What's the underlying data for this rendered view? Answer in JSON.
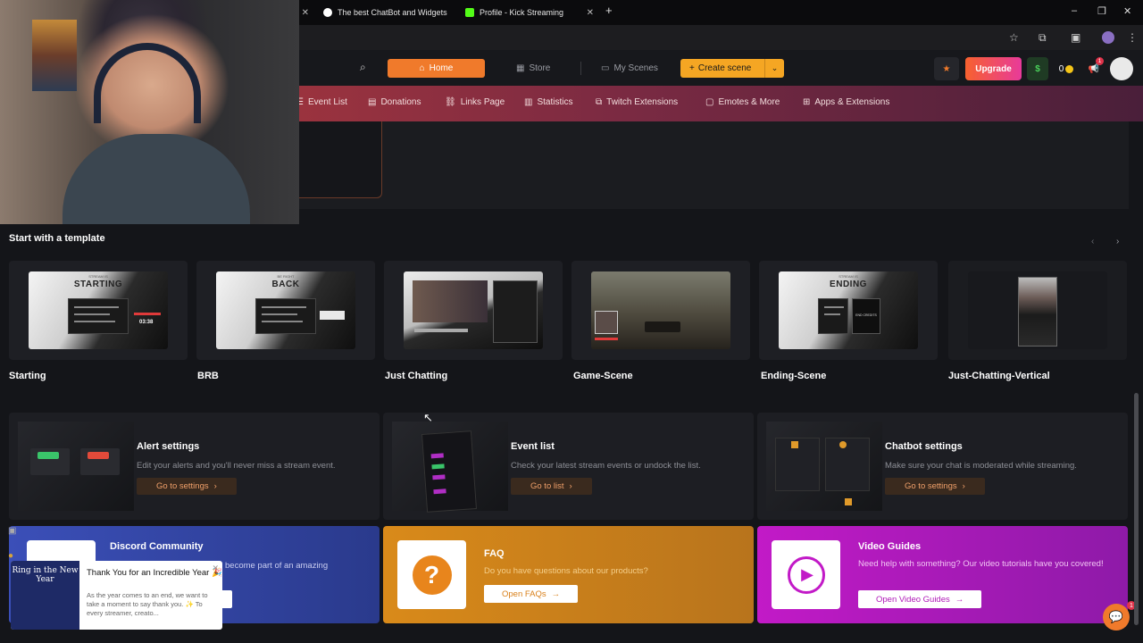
{
  "browser": {
    "tabs": [
      {
        "title": "The best ChatBot and Widgets",
        "close": "✕"
      },
      {
        "title": "Profile - Kick Streaming",
        "close": "✕"
      }
    ],
    "new_tab": "+",
    "window_controls": {
      "minimize": "–",
      "maximize": "❐",
      "close": "✕"
    }
  },
  "header": {
    "home": "Home",
    "store": "Store",
    "my_scenes": "My Scenes",
    "create_scene": "Create scene",
    "upgrade": "Upgrade",
    "dollar": "$",
    "coins": "0",
    "notif_count": "1"
  },
  "subnav": {
    "items": [
      {
        "label": "Event List",
        "icon": "list-icon"
      },
      {
        "label": "Donations",
        "icon": "donation-icon"
      },
      {
        "label": "Links Page",
        "icon": "link-icon"
      },
      {
        "label": "Statistics",
        "icon": "stats-icon"
      },
      {
        "label": "Twitch Extensions",
        "icon": "extension-icon"
      },
      {
        "label": "Emotes & More",
        "icon": "emote-icon"
      },
      {
        "label": "Apps & Extensions",
        "icon": "apps-icon"
      }
    ]
  },
  "templates": {
    "title": "Start with a template",
    "items": [
      {
        "label": "Starting",
        "thumb_title": "STARTING",
        "thumb_sub": "STREAM IS",
        "timer": "03:38"
      },
      {
        "label": "BRB",
        "thumb_title": "BACK",
        "thumb_sub": "BE RIGHT"
      },
      {
        "label": "Just Chatting"
      },
      {
        "label": "Game-Scene"
      },
      {
        "label": "Ending-Scene",
        "thumb_title": "ENDING",
        "thumb_sub": "STREAM IS",
        "thumb_extra": "END CREDITS"
      },
      {
        "label": "Just-Chatting-Vertical"
      }
    ]
  },
  "features": [
    {
      "title": "Alert settings",
      "desc": "Edit your alerts and you'll never miss a stream event.",
      "button": "Go to settings"
    },
    {
      "title": "Event list",
      "desc": "Check your latest stream events or undock the list.",
      "button": "Go to list"
    },
    {
      "title": "Chatbot settings",
      "desc": "Make sure your chat is moderated while streaming.",
      "button": "Go to settings"
    }
  ],
  "help": [
    {
      "title": "Discord Community",
      "desc": "become part of an amazing",
      "button": ""
    },
    {
      "title": "FAQ",
      "desc": "Do you have questions about our products?",
      "button": "Open FAQs"
    },
    {
      "title": "Video Guides",
      "desc": "Need help with something? Our video tutorials have you covered!",
      "button": "Open Video Guides"
    }
  ],
  "notification": {
    "title": "Thank You for an Incredible Year 🎉",
    "body": "As the year comes to an end, we want to take a moment to say thank you. ✨ To every streamer, creato...",
    "image_text": "Ring in the New Year",
    "close": "✕"
  },
  "chat_badge": "1",
  "colors": {
    "accent": "#f07a2b",
    "create": "#f5a623",
    "subnav_start": "#b83b3b",
    "faq": "#d98a1a",
    "video": "#c21ac7",
    "discord": "#3b4fb8"
  }
}
